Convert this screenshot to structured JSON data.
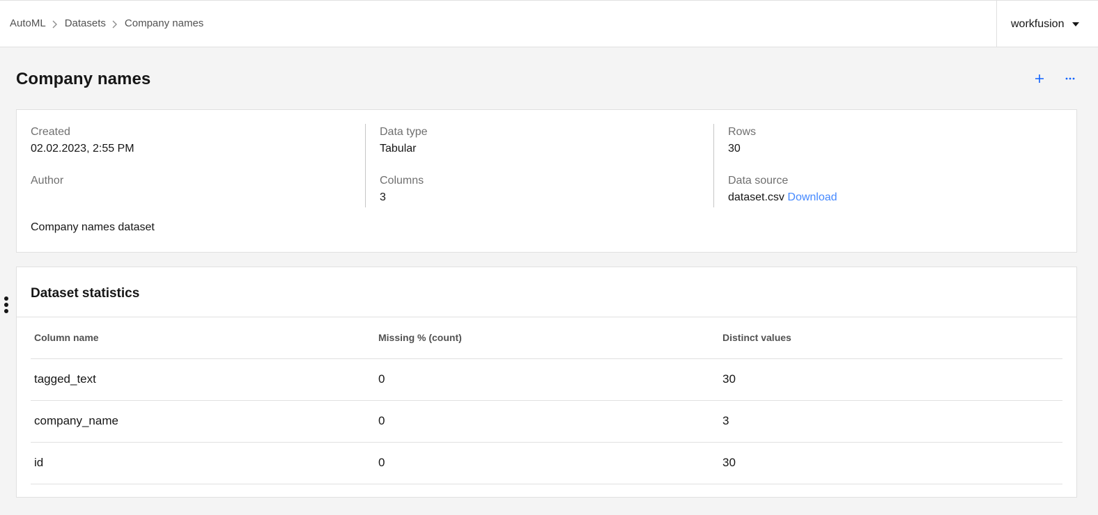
{
  "breadcrumb": [
    "AutoML",
    "Datasets",
    "Company names"
  ],
  "user": {
    "name": "workfusion"
  },
  "page": {
    "title": "Company names"
  },
  "info": {
    "created_label": "Created",
    "created_value": "02.02.2023, 2:55 PM",
    "author_label": "Author",
    "author_value": "",
    "data_type_label": "Data type",
    "data_type_value": "Tabular",
    "columns_label": "Columns",
    "columns_value": "3",
    "rows_label": "Rows",
    "rows_value": "30",
    "data_source_label": "Data source",
    "data_source_value": "dataset.csv",
    "download_label": "Download",
    "description": "Company names dataset"
  },
  "stats": {
    "title": "Dataset statistics",
    "headers": [
      "Column name",
      "Missing % (count)",
      "Distinct values"
    ],
    "rows": [
      [
        "tagged_text",
        "0",
        "30"
      ],
      [
        "company_name",
        "0",
        "3"
      ],
      [
        "id",
        "0",
        "30"
      ]
    ]
  },
  "icons": {
    "add": "plus-icon",
    "more": "overflow-menu-icon",
    "drag": "vertical-ellipsis-icon"
  },
  "colors": {
    "accent": "#0f62fe",
    "link": "#4589ff"
  }
}
